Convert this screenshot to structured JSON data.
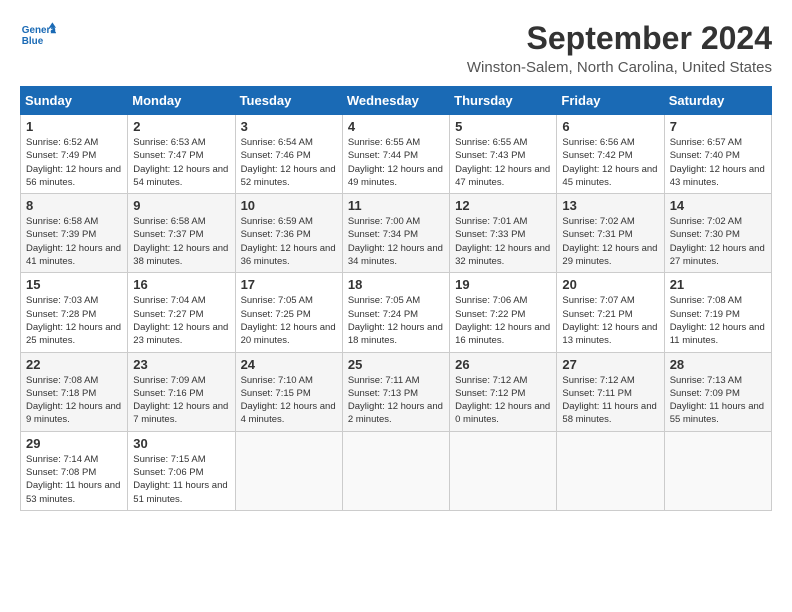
{
  "header": {
    "logo_line1": "General",
    "logo_line2": "Blue",
    "month_title": "September 2024",
    "location": "Winston-Salem, North Carolina, United States"
  },
  "calendar": {
    "days_of_week": [
      "Sunday",
      "Monday",
      "Tuesday",
      "Wednesday",
      "Thursday",
      "Friday",
      "Saturday"
    ],
    "weeks": [
      [
        null,
        {
          "day": "2",
          "sunrise": "6:53 AM",
          "sunset": "7:47 PM",
          "daylight": "12 hours and 54 minutes."
        },
        {
          "day": "3",
          "sunrise": "6:54 AM",
          "sunset": "7:46 PM",
          "daylight": "12 hours and 52 minutes."
        },
        {
          "day": "4",
          "sunrise": "6:55 AM",
          "sunset": "7:44 PM",
          "daylight": "12 hours and 49 minutes."
        },
        {
          "day": "5",
          "sunrise": "6:55 AM",
          "sunset": "7:43 PM",
          "daylight": "12 hours and 47 minutes."
        },
        {
          "day": "6",
          "sunrise": "6:56 AM",
          "sunset": "7:42 PM",
          "daylight": "12 hours and 45 minutes."
        },
        {
          "day": "7",
          "sunrise": "6:57 AM",
          "sunset": "7:40 PM",
          "daylight": "12 hours and 43 minutes."
        }
      ],
      [
        {
          "day": "1",
          "sunrise": "6:52 AM",
          "sunset": "7:49 PM",
          "daylight": "12 hours and 56 minutes."
        },
        null,
        null,
        null,
        null,
        null,
        null
      ],
      [
        {
          "day": "8",
          "sunrise": "6:58 AM",
          "sunset": "7:39 PM",
          "daylight": "12 hours and 41 minutes."
        },
        {
          "day": "9",
          "sunrise": "6:58 AM",
          "sunset": "7:37 PM",
          "daylight": "12 hours and 38 minutes."
        },
        {
          "day": "10",
          "sunrise": "6:59 AM",
          "sunset": "7:36 PM",
          "daylight": "12 hours and 36 minutes."
        },
        {
          "day": "11",
          "sunrise": "7:00 AM",
          "sunset": "7:34 PM",
          "daylight": "12 hours and 34 minutes."
        },
        {
          "day": "12",
          "sunrise": "7:01 AM",
          "sunset": "7:33 PM",
          "daylight": "12 hours and 32 minutes."
        },
        {
          "day": "13",
          "sunrise": "7:02 AM",
          "sunset": "7:31 PM",
          "daylight": "12 hours and 29 minutes."
        },
        {
          "day": "14",
          "sunrise": "7:02 AM",
          "sunset": "7:30 PM",
          "daylight": "12 hours and 27 minutes."
        }
      ],
      [
        {
          "day": "15",
          "sunrise": "7:03 AM",
          "sunset": "7:28 PM",
          "daylight": "12 hours and 25 minutes."
        },
        {
          "day": "16",
          "sunrise": "7:04 AM",
          "sunset": "7:27 PM",
          "daylight": "12 hours and 23 minutes."
        },
        {
          "day": "17",
          "sunrise": "7:05 AM",
          "sunset": "7:25 PM",
          "daylight": "12 hours and 20 minutes."
        },
        {
          "day": "18",
          "sunrise": "7:05 AM",
          "sunset": "7:24 PM",
          "daylight": "12 hours and 18 minutes."
        },
        {
          "day": "19",
          "sunrise": "7:06 AM",
          "sunset": "7:22 PM",
          "daylight": "12 hours and 16 minutes."
        },
        {
          "day": "20",
          "sunrise": "7:07 AM",
          "sunset": "7:21 PM",
          "daylight": "12 hours and 13 minutes."
        },
        {
          "day": "21",
          "sunrise": "7:08 AM",
          "sunset": "7:19 PM",
          "daylight": "12 hours and 11 minutes."
        }
      ],
      [
        {
          "day": "22",
          "sunrise": "7:08 AM",
          "sunset": "7:18 PM",
          "daylight": "12 hours and 9 minutes."
        },
        {
          "day": "23",
          "sunrise": "7:09 AM",
          "sunset": "7:16 PM",
          "daylight": "12 hours and 7 minutes."
        },
        {
          "day": "24",
          "sunrise": "7:10 AM",
          "sunset": "7:15 PM",
          "daylight": "12 hours and 4 minutes."
        },
        {
          "day": "25",
          "sunrise": "7:11 AM",
          "sunset": "7:13 PM",
          "daylight": "12 hours and 2 minutes."
        },
        {
          "day": "26",
          "sunrise": "7:12 AM",
          "sunset": "7:12 PM",
          "daylight": "12 hours and 0 minutes."
        },
        {
          "day": "27",
          "sunrise": "7:12 AM",
          "sunset": "7:11 PM",
          "daylight": "11 hours and 58 minutes."
        },
        {
          "day": "28",
          "sunrise": "7:13 AM",
          "sunset": "7:09 PM",
          "daylight": "11 hours and 55 minutes."
        }
      ],
      [
        {
          "day": "29",
          "sunrise": "7:14 AM",
          "sunset": "7:08 PM",
          "daylight": "11 hours and 53 minutes."
        },
        {
          "day": "30",
          "sunrise": "7:15 AM",
          "sunset": "7:06 PM",
          "daylight": "11 hours and 51 minutes."
        },
        null,
        null,
        null,
        null,
        null
      ]
    ]
  }
}
